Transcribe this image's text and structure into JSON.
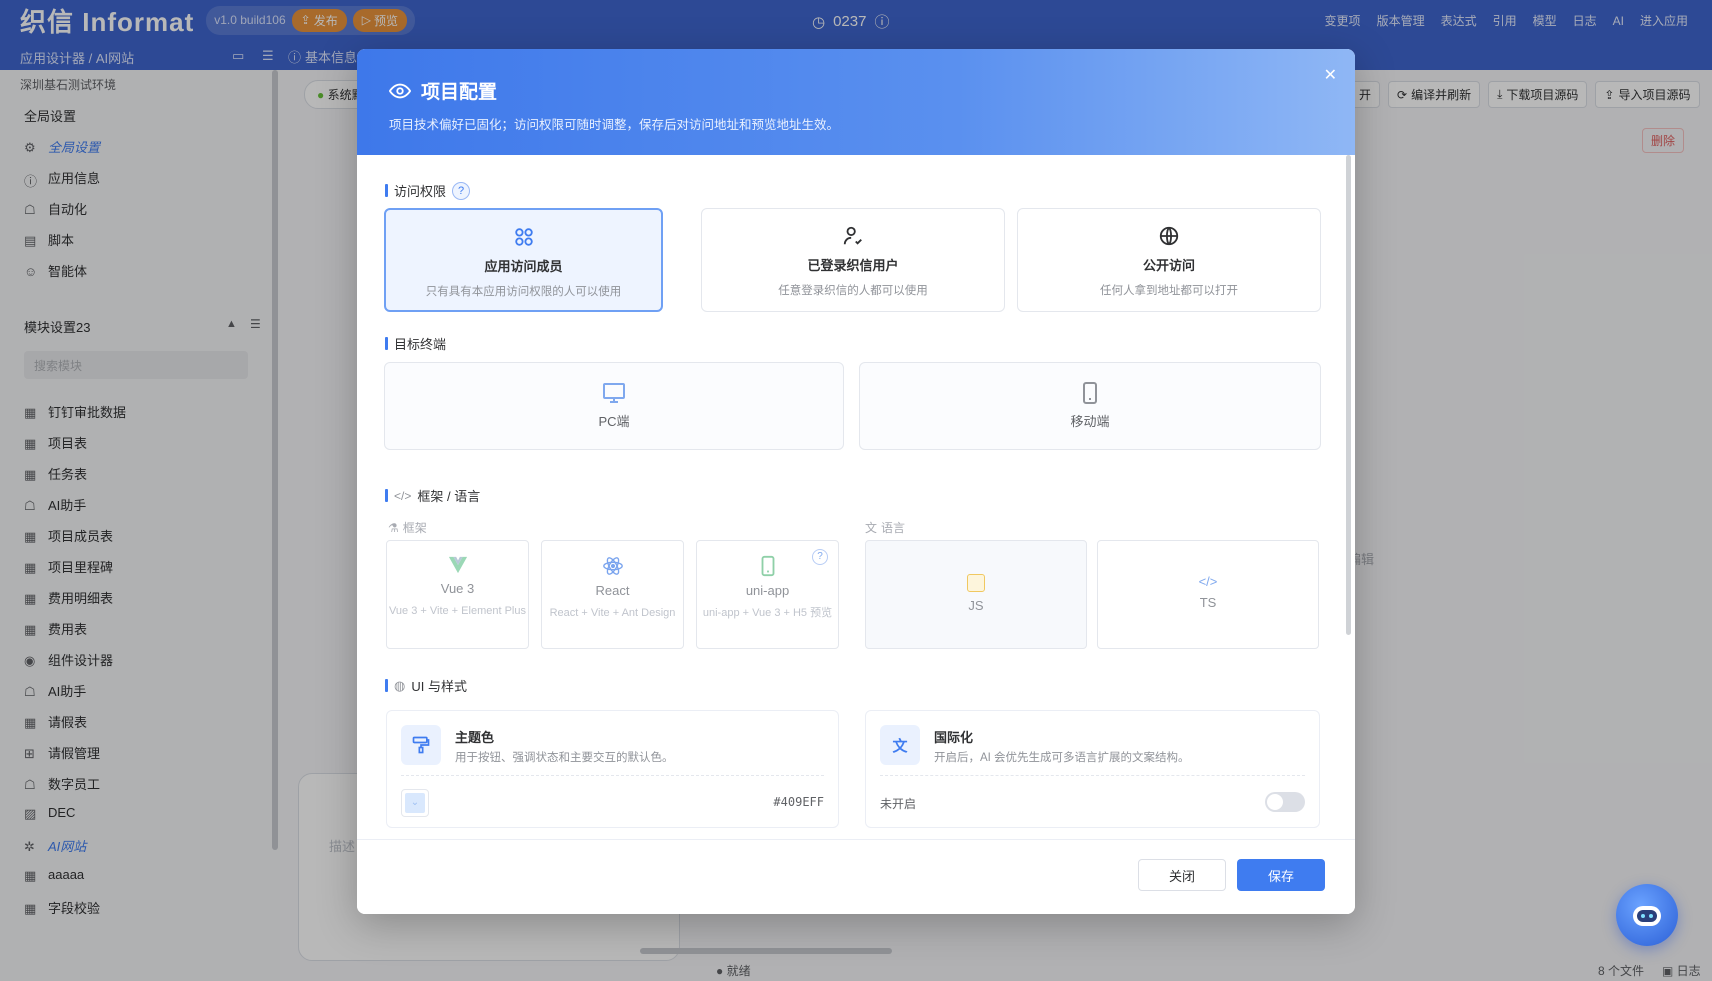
{
  "topbar": {
    "logo_text": "织信 Informat",
    "version": "v1.0 build106",
    "publish_label": "发布",
    "preview_label": "预览",
    "counter": "0237",
    "right_menu": [
      "变更项",
      "版本管理",
      "表达式",
      "引用",
      "模型",
      "日志",
      "AI",
      "进入应用"
    ]
  },
  "subbar": {
    "breadcrumb": "应用设计器 / AI网站",
    "basic_info": "基本信息"
  },
  "sidebar": {
    "env": "深圳基石测试环境",
    "global_section": "全局设置",
    "nav": [
      {
        "label": "全局设置",
        "icon": "gear-icon",
        "active": true
      },
      {
        "label": "应用信息",
        "icon": "info-icon"
      },
      {
        "label": "自动化",
        "icon": "robot-icon"
      },
      {
        "label": "脚本",
        "icon": "script-icon"
      },
      {
        "label": "智能体",
        "icon": "agent-icon"
      }
    ],
    "modules_title": "模块设置23",
    "search_placeholder": "搜索模块",
    "modules": [
      {
        "label": "钉钉审批数据",
        "icon": "table-icon"
      },
      {
        "label": "项目表",
        "icon": "table-icon"
      },
      {
        "label": "任务表",
        "icon": "table-icon"
      },
      {
        "label": "AI助手",
        "icon": "robot-icon"
      },
      {
        "label": "项目成员表",
        "icon": "table-icon"
      },
      {
        "label": "项目里程碑",
        "icon": "table-icon"
      },
      {
        "label": "费用明细表",
        "icon": "table-icon"
      },
      {
        "label": "费用表",
        "icon": "table-icon"
      },
      {
        "label": "组件设计器",
        "icon": "component-icon"
      },
      {
        "label": "AI助手",
        "icon": "robot-icon"
      },
      {
        "label": "请假表",
        "icon": "table-icon"
      },
      {
        "label": "请假管理",
        "icon": "workflow-icon"
      },
      {
        "label": "数字员工",
        "icon": "robot-icon"
      },
      {
        "label": "DEC",
        "icon": "doc-icon"
      },
      {
        "label": "AI网站",
        "icon": "web-icon",
        "active": true
      },
      {
        "label": "aaaaa",
        "icon": "table-icon"
      },
      {
        "label": "字段校验",
        "icon": "table-icon"
      }
    ]
  },
  "background": {
    "tab_label": "系统默",
    "buttons": [
      "开",
      "编译并刷新",
      "下载项目源码",
      "导入项目源码"
    ],
    "delete_label": "删除",
    "edit_hint": "编辑",
    "status_ready": "就绪",
    "file_count": "8 个文件",
    "log_label": "日志",
    "input_placeholder": "描述"
  },
  "modal": {
    "title": "项目配置",
    "subtitle": "项目技术偏好已固化；访问权限可随时调整，保存后对访问地址和预览地址生效。",
    "access": {
      "title": "访问权限",
      "options": [
        {
          "title": "应用访问成员",
          "desc": "只有具有本应用访问权限的人可以使用",
          "icon": "members-icon",
          "selected": true
        },
        {
          "title": "已登录织信用户",
          "desc": "任意登录织信的人都可以使用",
          "icon": "user-check-icon"
        },
        {
          "title": "公开访问",
          "desc": "任何人拿到地址都可以打开",
          "icon": "globe-icon"
        }
      ]
    },
    "terminal": {
      "title": "目标终端",
      "options": [
        {
          "title": "PC端",
          "icon": "monitor-icon"
        },
        {
          "title": "移动端",
          "icon": "mobile-icon"
        }
      ]
    },
    "framework": {
      "title": "框架 / 语言",
      "framework_label": "框架",
      "language_label": "语言",
      "frameworks": [
        {
          "title": "Vue 3",
          "desc": "Vue 3 + Vite + Element Plus",
          "icon": "vue-icon"
        },
        {
          "title": "React",
          "desc": "React + Vite + Ant Design",
          "icon": "react-icon"
        },
        {
          "title": "uni-app",
          "desc": "uni-app + Vue 3 + H5 预览",
          "icon": "mobile-icon"
        }
      ],
      "languages": [
        {
          "title": "JS",
          "icon": "js-icon",
          "selected": true
        },
        {
          "title": "TS",
          "icon": "code-icon"
        }
      ]
    },
    "ui": {
      "title": "UI 与样式",
      "theme": {
        "title": "主题色",
        "desc": "用于按钮、强调状态和主要交互的默认色。",
        "value": "#409EFF"
      },
      "i18n": {
        "title": "国际化",
        "desc": "开启后，AI 会优先生成可多语言扩展的文案结构。",
        "status": "未开启",
        "enabled": false
      }
    },
    "close_label": "关闭",
    "save_label": "保存"
  },
  "colors": {
    "accent": "#3f7cf0",
    "topbar": "#3f66cf",
    "publish": "#e9943c"
  }
}
